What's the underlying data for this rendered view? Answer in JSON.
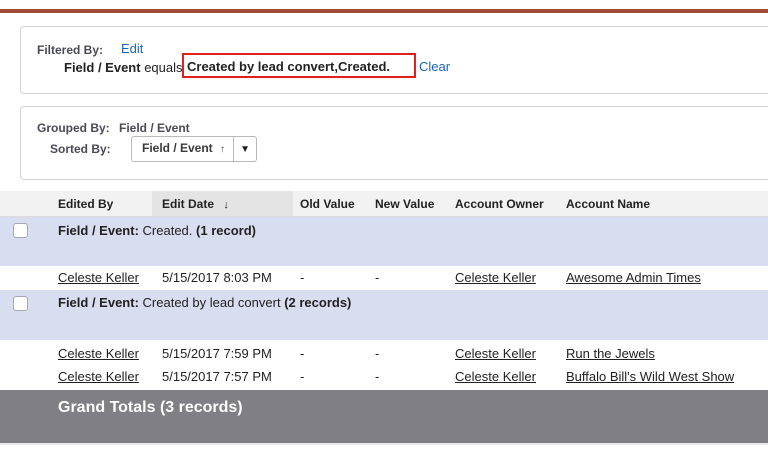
{
  "filter": {
    "label": "Filtered By:",
    "edit_link": "Edit",
    "criteria_field": "Field / Event",
    "criteria_op": "equals",
    "criteria_value": "Created by lead convert,Created.",
    "clear_link": "Clear"
  },
  "grouping": {
    "grouped_label": "Grouped By:",
    "grouped_value": "Field / Event",
    "sorted_label": "Sorted By:",
    "sort_value": "Field / Event",
    "sort_arrow": "↑",
    "caret": "▼"
  },
  "table": {
    "columns": [
      "Edited By",
      "Edit Date",
      "Old Value",
      "New Value",
      "Account Owner",
      "Account Name"
    ],
    "sort_indicator": "↓",
    "groups": [
      {
        "label": "Field / Event:",
        "value": "Created.",
        "count": "(1 record)",
        "rows": [
          {
            "edited_by": "Celeste Keller",
            "edit_date": "5/15/2017 8:03 PM",
            "old_value": "-",
            "new_value": "-",
            "account_owner": "Celeste Keller",
            "account_name": "Awesome Admin Times"
          }
        ]
      },
      {
        "label": "Field / Event:",
        "value": "Created by lead convert",
        "count": "(2 records)",
        "rows": [
          {
            "edited_by": "Celeste Keller",
            "edit_date": "5/15/2017 7:59 PM",
            "old_value": "-",
            "new_value": "-",
            "account_owner": "Celeste Keller",
            "account_name": "Run the Jewels"
          },
          {
            "edited_by": "Celeste Keller",
            "edit_date": "5/15/2017 7:57 PM",
            "old_value": "-",
            "new_value": "-",
            "account_owner": "Celeste Keller",
            "account_name": "Buffalo Bill's Wild West Show"
          }
        ]
      }
    ],
    "grand_totals": "Grand Totals (3 records)"
  },
  "colors": {
    "accent_bar": "#a34a36",
    "highlight_border": "#e0201c",
    "group_row_bg": "#d8def0",
    "grand_totals_bg": "#7f7f85",
    "link": "#1a66b6"
  }
}
